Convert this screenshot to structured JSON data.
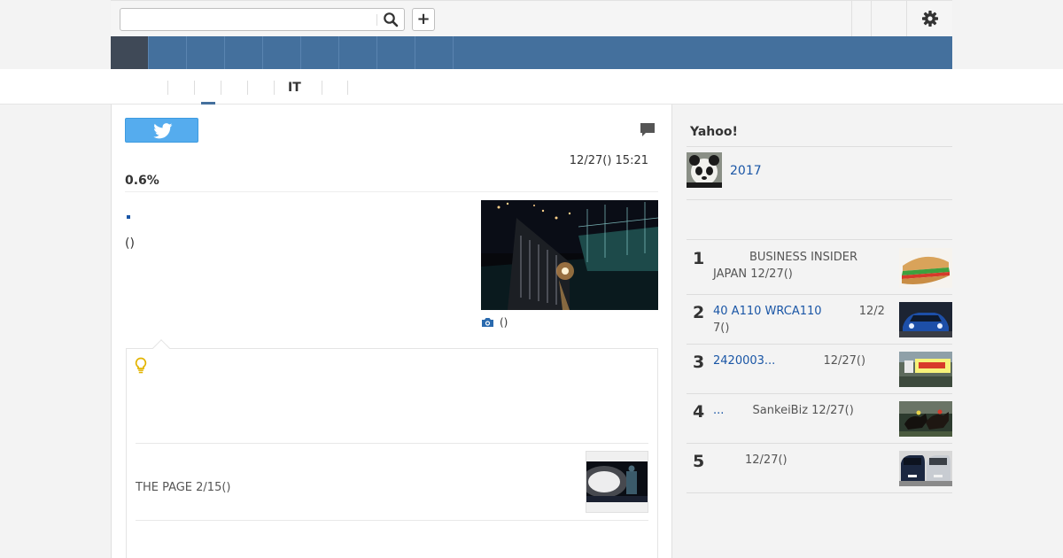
{
  "search": {
    "placeholder": "",
    "value": ""
  },
  "topbar": {
    "plus_label": "+"
  },
  "nav": {
    "items": [
      "",
      "",
      "",
      "",
      "",
      "",
      "",
      "",
      ""
    ]
  },
  "subnav": {
    "items": [
      "",
      "",
      "",
      "",
      "",
      "IT",
      "",
      ""
    ]
  },
  "article": {
    "date": "12/27() 15:21",
    "headline": "0.6%",
    "paren_text": "()",
    "photo_caption": "()",
    "related_text": "THE PAGE 2/15()"
  },
  "sidebar": {
    "title": "Yahoo!",
    "feature_link": "2017",
    "ranking": [
      {
        "rank": "1",
        "title": "",
        "meta": "BUSINESS INSIDER JAPAN 12/27()"
      },
      {
        "rank": "2",
        "title": "40 A110 WRCA110",
        "meta": "12/27()"
      },
      {
        "rank": "3",
        "title": "2420003...",
        "meta": "12/27()"
      },
      {
        "rank": "4",
        "title": "...",
        "meta": "SankeiBiz 12/27()"
      },
      {
        "rank": "5",
        "title": "",
        "meta": "12/27()"
      }
    ]
  },
  "colors": {
    "nav_bg": "#44709d",
    "nav_active": "#3f4957",
    "link_blue": "#1a56a6",
    "twitter_blue": "#55acee"
  }
}
